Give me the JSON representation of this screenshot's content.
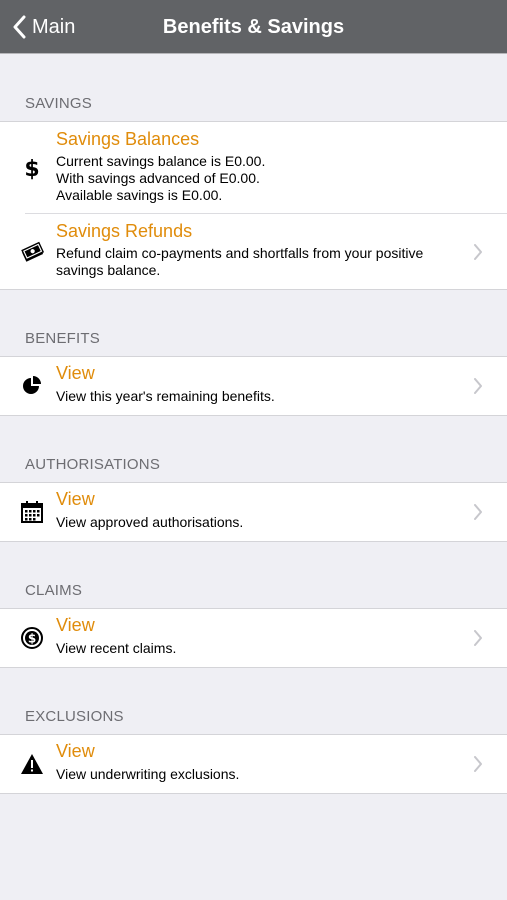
{
  "navbar": {
    "back_label": "Main",
    "title": "Benefits & Savings"
  },
  "sections": {
    "savings": {
      "header": "SAVINGS",
      "balances": {
        "title": "Savings Balances",
        "line1": "Current savings balance is E0.00.",
        "line2": "With savings advanced of E0.00.",
        "line3": "Available savings is E0.00."
      },
      "refunds": {
        "title": "Savings Refunds",
        "description": "Refund claim co-payments and shortfalls from your positive savings balance."
      }
    },
    "benefits": {
      "header": "BENEFITS",
      "title": "View",
      "description": "View this year's remaining benefits."
    },
    "authorisations": {
      "header": "AUTHORISATIONS",
      "title": "View",
      "description": "View approved authorisations."
    },
    "claims": {
      "header": "CLAIMS",
      "title": "View",
      "description": "View recent claims."
    },
    "exclusions": {
      "header": "EXCLUSIONS",
      "title": "View",
      "description": "View underwriting exclusions."
    }
  },
  "colors": {
    "navbar": "#616366",
    "accent": "#e08c0b",
    "background": "#efeff4"
  },
  "icons": {
    "back": "chevron-left-icon",
    "balances": "dollar-icon",
    "refunds": "money-icon",
    "benefits": "pie-chart-icon",
    "authorisations": "calendar-icon",
    "claims": "coin-icon",
    "exclusions": "warning-icon",
    "disclosure": "chevron-right-icon"
  }
}
